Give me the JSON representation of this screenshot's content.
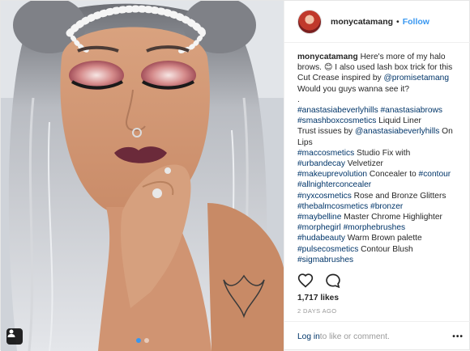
{
  "header": {
    "username": "monycatamang",
    "separator": "•",
    "follow_label": "Follow"
  },
  "caption": {
    "username": "monycatamang",
    "lines": [
      {
        "text": " Here's more of my halo brows. 😊 I also used lash box trick for this Cut Crease inspired by "
      },
      {
        "tag": "@promisetamang"
      },
      {
        "text": " Would you guys wanna see it?"
      }
    ],
    "dot": ".",
    "l1a": "#anastasiabeverlyhills",
    "l1b": "#anastasiabrows",
    "l2a": "#smashboxcosmetics",
    "l2b": " Liquid Liner",
    "l3a": "Trust issues by ",
    "l3b": "@anastasiabeverlyhills",
    "l3c": " On Lips",
    "l4a": "#maccosmetics",
    "l4b": " Studio Fix with",
    "l5a": "#urbandecay",
    "l5b": " Velvetizer",
    "l6a": "#makeuprevolution",
    "l6b": " Concealer to ",
    "l6c": "#contour",
    "l7a": "#allnighterconcealer",
    "l8a": "#nyxcosmetics",
    "l8b": " Rose and Bronze Glitters",
    "l9a": "#thebalmcosmetics",
    "l9b": "#bronzer",
    "l10a": "#maybelline",
    "l10b": " Master Chrome Highlighter",
    "l11a": "#morphegirl",
    "l11b": "#morphebrushes",
    "l12a": "#hudabeauty",
    "l12b": " Warm Brown palette",
    "l13a": "#pulsecosmetics",
    "l13b": " Contour Blush",
    "l14a": "#sigmabrushes"
  },
  "likes": "1,717 likes",
  "age": "2 DAYS AGO",
  "comment": {
    "login_label": "Log in",
    "rest": " to like or comment.",
    "more": "•••"
  },
  "icons": {
    "like": "heart-icon",
    "comment": "comment-bubble-icon",
    "user_tag": "person-tag-icon"
  },
  "colors": {
    "link": "#003569",
    "follow": "#3897f0",
    "muted": "#999999"
  }
}
